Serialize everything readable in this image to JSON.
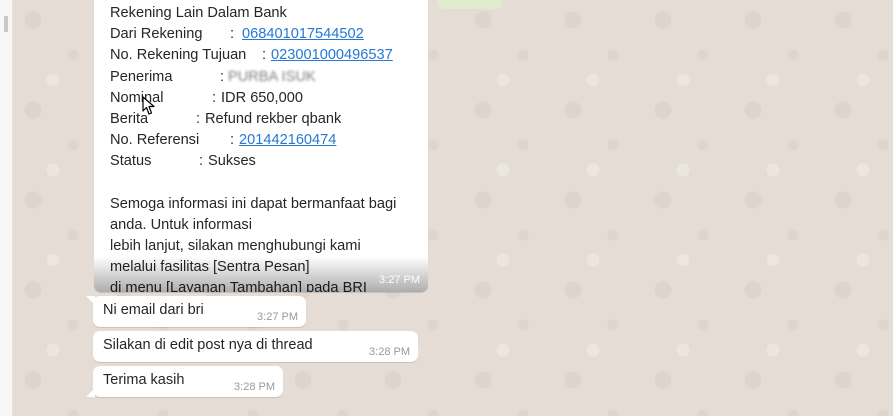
{
  "conversation": {
    "main_message": {
      "rows": [
        {
          "label": "Rekening Lain Dalam Bank",
          "sep": "",
          "value": "",
          "link": false
        },
        {
          "label": "Dari Rekening",
          "sep": ":",
          "value": "068401017544502",
          "link": true
        },
        {
          "label": "No. Rekening Tujuan",
          "sep": ":",
          "value": "023001000496537",
          "link": true
        },
        {
          "label": "Penerima",
          "sep": ":",
          "value": "PURBA ISUK",
          "link": false
        },
        {
          "label": "Nominal",
          "sep": ":",
          "value": "IDR 650,000",
          "link": false
        },
        {
          "label": "Berita",
          "sep": ":",
          "value": "Refund rekber qbank",
          "link": false
        },
        {
          "label": "No. Referensi",
          "sep": ":",
          "value": "201442160474",
          "link": true
        },
        {
          "label": "Status",
          "sep": ":",
          "value": "Sukses",
          "link": false
        }
      ],
      "closing_lines": [
        "Semoga informasi ini dapat bermanfaat bagi",
        "anda. Untuk informasi",
        "lebih lanjut, silakan menghubungi kami",
        "melalui fasilitas [Sentra Pesan]",
        "di menu [Layanan Tambahan] pada BRI"
      ],
      "time": "3:27 PM"
    },
    "messages": [
      {
        "text": "Ni email dari bri",
        "time": "3:27 PM"
      },
      {
        "text": "Silakan di edit post nya di thread",
        "time": "3:28 PM"
      },
      {
        "text": "Terima kasih",
        "time": "3:28 PM"
      }
    ]
  },
  "icons": [
    "mouse-cursor-icon"
  ],
  "colors": {
    "chat_background": "#e5ddd5",
    "incoming_bubble": "#ffffff",
    "link": "#2679d3",
    "outgoing_bubble": "#dcf8c6"
  }
}
